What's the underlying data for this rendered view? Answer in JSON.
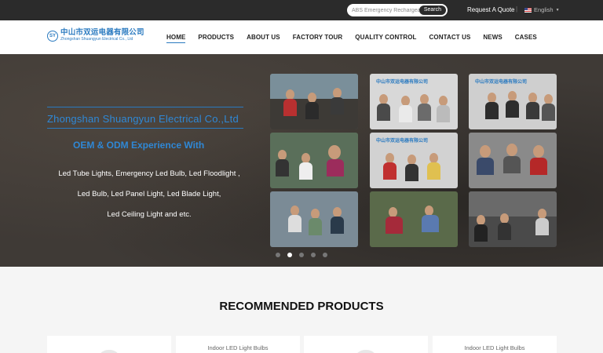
{
  "topbar": {
    "search_placeholder": "ABS Emergency Rechargeab",
    "search_button": "Search",
    "quote_link": "Request A Quote",
    "separator": "|",
    "language": "English"
  },
  "header": {
    "logo_mark": "SY",
    "logo_cn": "中山市双运电器有限公司",
    "logo_en": "Zhongshan Shuangyun Electrical Co., Ltd",
    "nav": [
      {
        "label": "HOME",
        "active": true
      },
      {
        "label": "PRODUCTS",
        "active": false
      },
      {
        "label": "ABOUT US",
        "active": false
      },
      {
        "label": "FACTORY TOUR",
        "active": false
      },
      {
        "label": "QUALITY CONTROL",
        "active": false
      },
      {
        "label": "CONTACT US",
        "active": false
      },
      {
        "label": "NEWS",
        "active": false
      },
      {
        "label": "CASES",
        "active": false
      }
    ]
  },
  "hero": {
    "company": "Zhongshan Shuangyun Electrical Co.,Ltd",
    "oem": "OEM & ODM Experience With",
    "products_lines": [
      "Led Tube Lights, Emergency Led Bulb, Led Floodlight ,",
      "Led Bulb, Led Panel Light, Led Blade Light,",
      "Led Ceiling Light and etc."
    ],
    "photo_sign": "中山市双运电器有限公司",
    "slider_total": 5,
    "slider_active": 2
  },
  "recommended": {
    "title": "RECOMMENDED PRODUCTS",
    "cards": [
      {
        "label": ""
      },
      {
        "label": "Indoor LED Light Bulbs"
      },
      {
        "label": ""
      },
      {
        "label": "Indoor LED Light Bulbs"
      }
    ]
  }
}
